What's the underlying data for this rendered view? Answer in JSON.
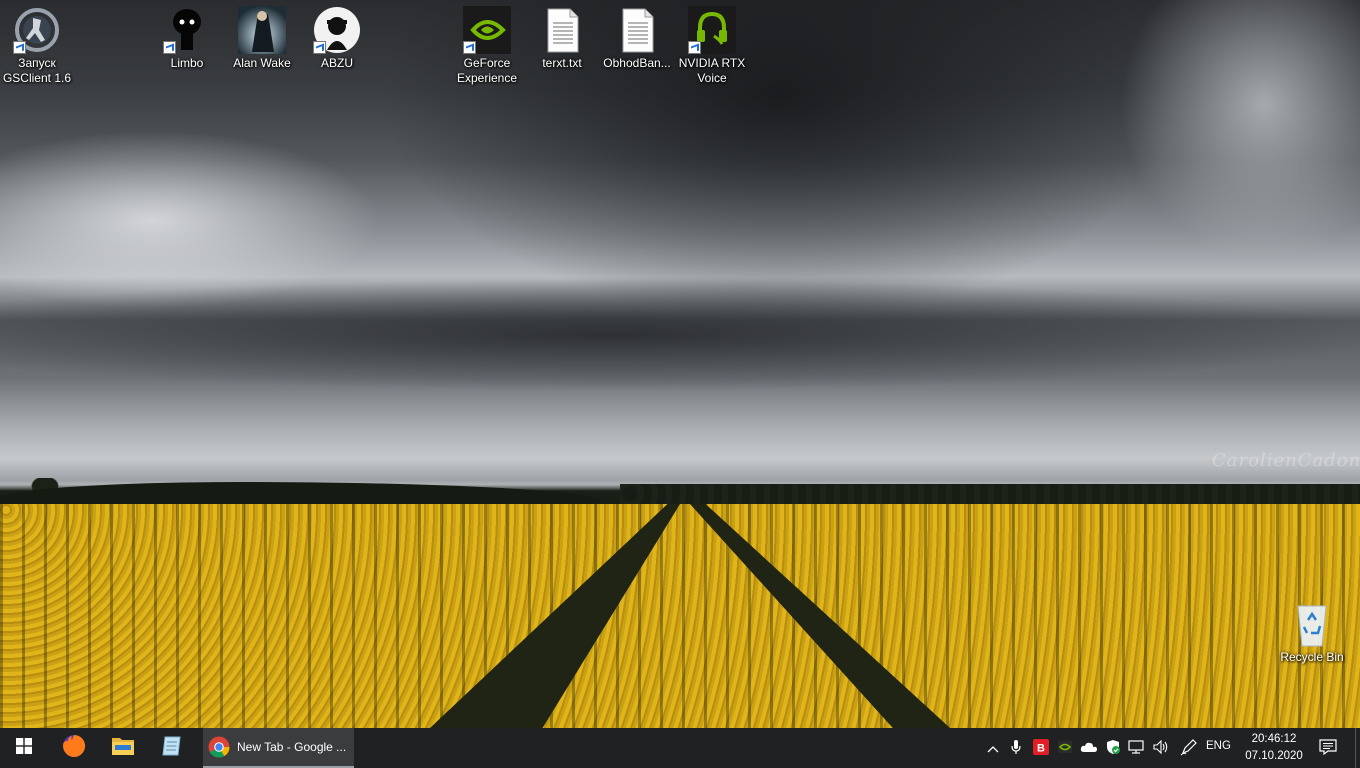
{
  "desktop": {
    "watermark": "CarolienCadoni",
    "icons": [
      {
        "label": "Запуск GSClient 1.6",
        "icon": "counter-strike-icon"
      },
      {
        "label": "Limbo",
        "icon": "limbo-icon"
      },
      {
        "label": "Alan Wake",
        "icon": "alan-wake-icon"
      },
      {
        "label": "ABZU",
        "icon": "abzu-icon"
      },
      {
        "label": "GeForce Experience",
        "icon": "nvidia-geforce-icon"
      },
      {
        "label": "terxt.txt",
        "icon": "text-file-icon"
      },
      {
        "label": "ObhodBan...",
        "icon": "text-file-icon"
      },
      {
        "label": "NVIDIA RTX Voice",
        "icon": "nvidia-rtx-voice-icon"
      },
      {
        "label": "Recycle Bin",
        "icon": "recycle-bin-icon"
      }
    ]
  },
  "taskbar": {
    "pinned": [
      {
        "name": "start",
        "icon": "windows-logo-icon"
      },
      {
        "name": "firefox",
        "icon": "firefox-icon"
      },
      {
        "name": "file-explorer",
        "icon": "folder-icon"
      },
      {
        "name": "notepad",
        "icon": "notepad-icon"
      }
    ],
    "active_window": {
      "title": "New Tab - Google ...",
      "icon": "chrome-icon"
    },
    "tray": {
      "language": "ENG",
      "time": "20:46:12",
      "date": "07.10.2020"
    },
    "colors": {
      "background": "#1f2122",
      "active": "#3a3c3d"
    }
  }
}
